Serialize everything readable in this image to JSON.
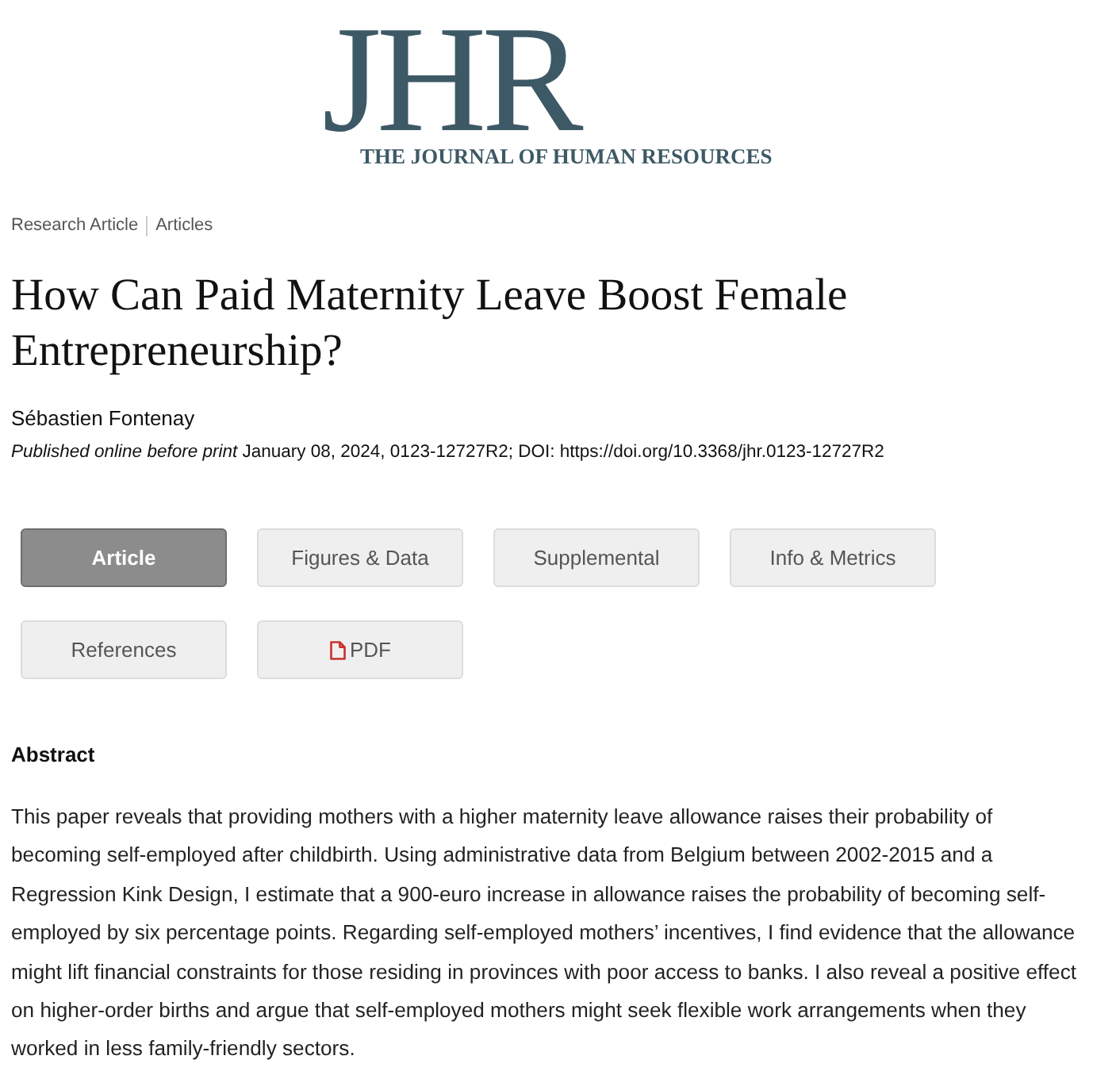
{
  "logo": {
    "initials": "JHR",
    "tagline": "THE JOURNAL OF HUMAN RESOURCES"
  },
  "breadcrumbs": [
    {
      "label": "Research Article"
    },
    {
      "label": "Articles"
    }
  ],
  "article": {
    "title": "How Can Paid Maternity Leave Boost Female Entrepreneurship?",
    "author": "Sébastien Fontenay",
    "publication": "*Published online before print* January 08, 2024, 0123-12727R2; DOI: https://doi.org/10.3368/jhr.0123-12727R2"
  },
  "tabs": [
    {
      "label": "Article",
      "selected": true,
      "kind": "text"
    },
    {
      "label": "Figures & Data",
      "selected": false,
      "kind": "text"
    },
    {
      "label": "Supplemental",
      "selected": false,
      "kind": "text"
    },
    {
      "label": "Info & Metrics",
      "selected": false,
      "kind": "text"
    },
    {
      "label": "References",
      "selected": false,
      "kind": "text"
    },
    {
      "label": "PDF",
      "selected": false,
      "kind": "pdf"
    }
  ],
  "abstract": {
    "heading": "Abstract",
    "text": "This paper reveals that providing mothers with a higher maternity leave allowance raises their probability of becoming self-employed after childbirth. Using administrative data from Belgium between 2002-2015 and a Regression Kink Design, I estimate that a 900-euro increase in allowance raises the probability of becoming self-employed by six percentage points. Regarding self-employed mothers’ incentives, I find evidence that the allowance might lift financial constraints for those residing in provinces with poor access to banks. I also reveal a positive effect on higher-order births and argue that self-employed mothers might seek flexible work arrangements when they worked in less family-friendly sectors."
  }
}
